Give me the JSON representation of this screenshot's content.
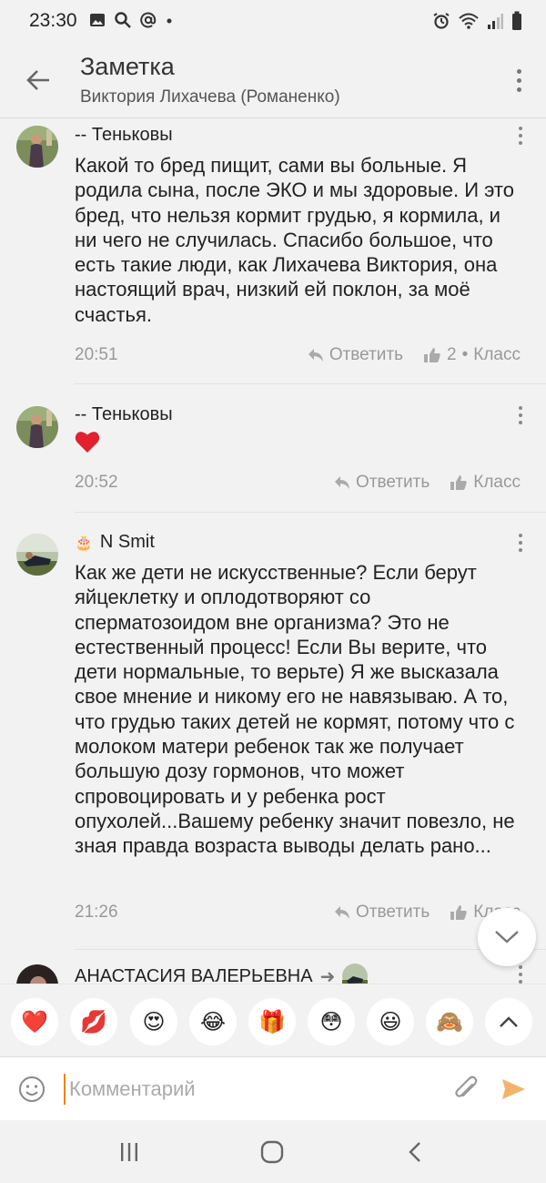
{
  "status_bar": {
    "time": "23:30"
  },
  "header": {
    "title": "Заметка",
    "subtitle": "Виктория Лихачева (Романенко)"
  },
  "comments": [
    {
      "author": "-- Теньковы",
      "text": "Какой то бред пищит, сами вы больные. Я родила сына, после ЭКО и мы здоровые. И это бред, что нельзя кормит грудью, я кормила, и ни чего не случилась. Спасибо большое, что есть такие люди, как Лихачева Виктория, она настоящий врач, низкий ей поклон, за моё счастья.",
      "time": "20:51",
      "reply_label": "Ответить",
      "like_count": "2",
      "like_separator": "•",
      "like_label": "Класс"
    },
    {
      "author": "-- Теньковы",
      "text": "❤️",
      "time": "20:52",
      "reply_label": "Ответить",
      "like_label": "Класс"
    },
    {
      "author": "N Smit",
      "author_badge": "🎂",
      "text": "Как же дети не искусственные? Если берут яйцеклетку и оплодотворяют со сперматозоидом вне организма? Это не естественный процесс! Если Вы верите, что дети нормальные, то верьте) Я же высказала свое мнение и никому его не навязываю. А то, что грудью таких детей не кормят, потому что с молоком матери ребенок так же получает большую дозу гормонов, что может спровоцировать и у ребенка рост опухолей...Вашему ребенку значит повезло, не зная правда возраста выводы делать рано...",
      "time": "21:26",
      "reply_label": "Ответить",
      "like_label": "Класс"
    },
    {
      "author": "АНАСТАСИЯ ВАЛЕРЬЕВНА",
      "reply_arrow": "➜"
    }
  ],
  "emoji_bar": {
    "items": [
      "❤️",
      "💋",
      "😍",
      "😂",
      "🎁",
      "😳",
      "😃",
      "🙈"
    ]
  },
  "input_bar": {
    "placeholder": "Комментарий",
    "value": ""
  },
  "colors": {
    "accent": "#ee8208",
    "background": "#f2f2f2",
    "muted_text": "#999999"
  }
}
